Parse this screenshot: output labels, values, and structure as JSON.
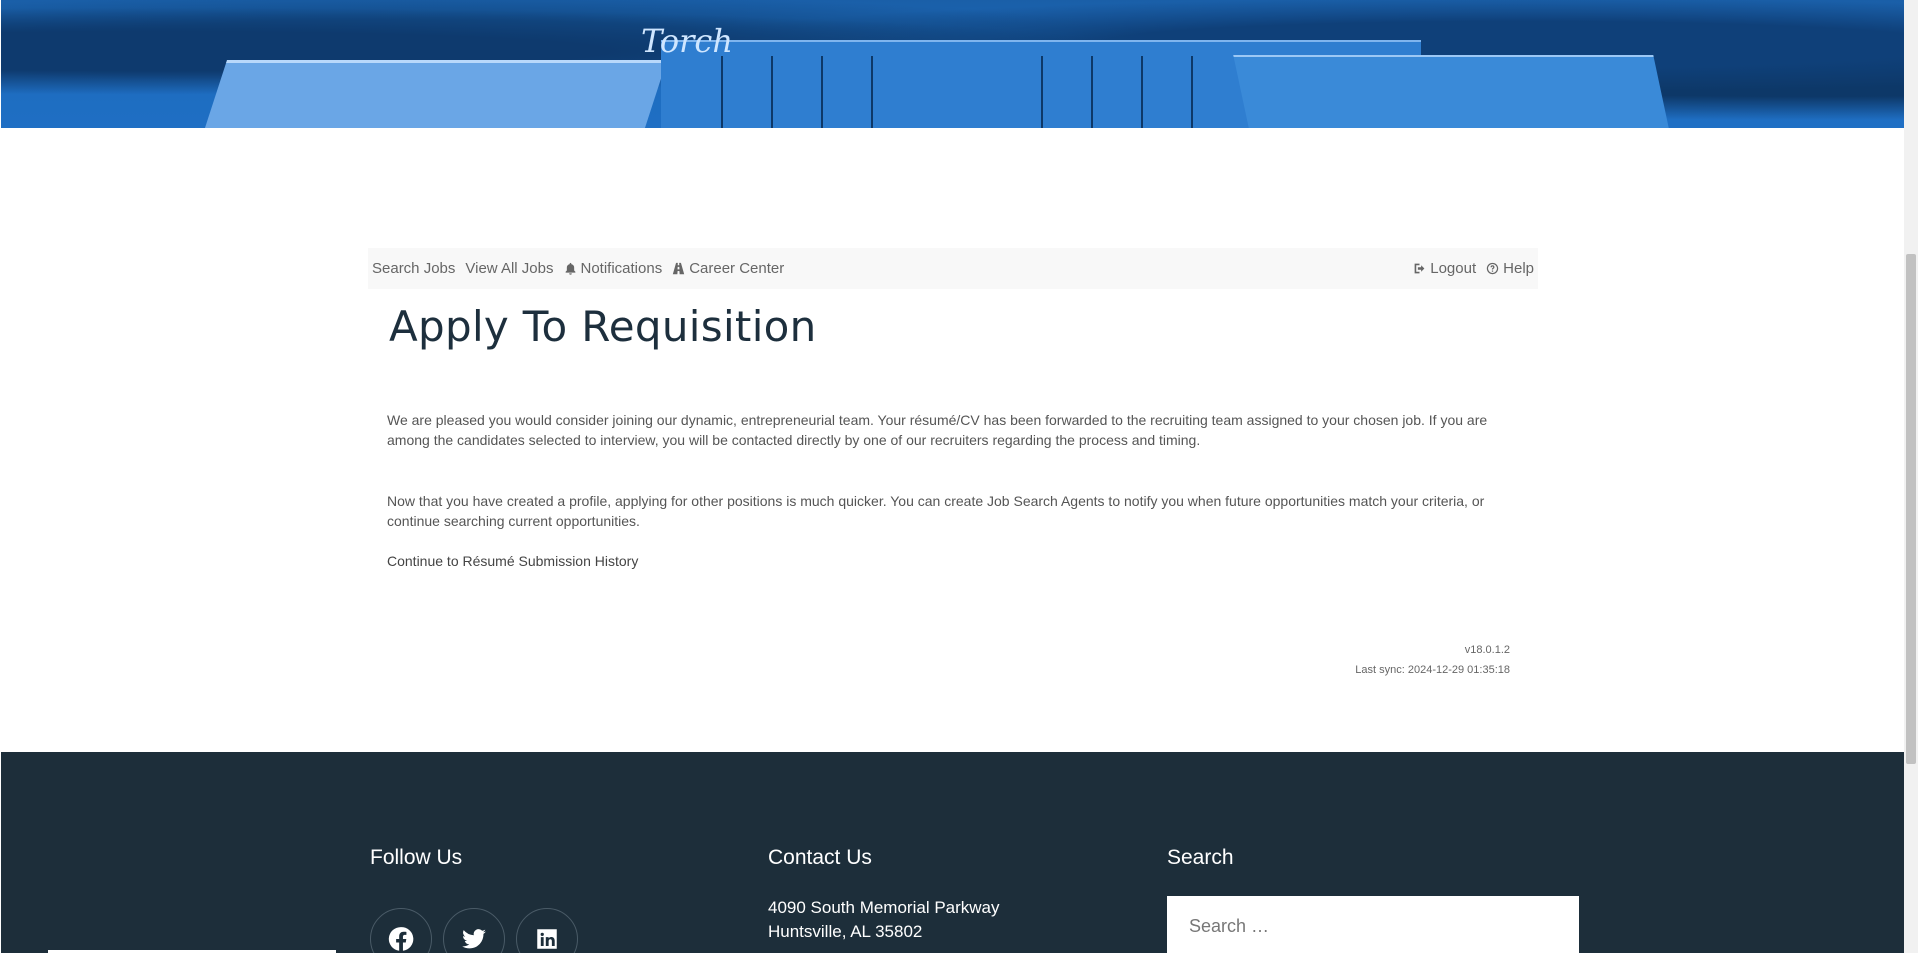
{
  "nav": {
    "search_jobs": "Search Jobs",
    "view_all_jobs": "View All Jobs",
    "notifications": "Notifications",
    "career_center": "Career Center",
    "logout": "Logout",
    "help": "Help"
  },
  "main": {
    "title": "Apply To Requisition",
    "paragraph1": "We are pleased you would consider joining our dynamic, entrepreneurial team. Your résumé/CV has been forwarded to the recruiting team assigned to your chosen job. If you are among the candidates selected to interview, you will be contacted directly by one of our recruiters regarding the process and timing.",
    "paragraph2": "Now that you have created a profile, applying for other positions is much quicker. You can create Job Search Agents to notify you when future opportunities match your criteria, or continue searching current opportunities.",
    "continue_link": "Continue to Résumé Submission History"
  },
  "meta": {
    "version": "v18.0.1.2",
    "last_sync": "Last sync: 2024-12-29 01:35:18"
  },
  "hero": {
    "sign_text": "Torch"
  },
  "footer": {
    "follow_title": "Follow Us",
    "contact_title": "Contact Us",
    "search_title": "Search",
    "address_line1": "4090 South Memorial Parkway",
    "address_line2": "Huntsville, AL 35802",
    "search_placeholder": "Search …",
    "social": [
      "facebook-icon",
      "twitter-icon",
      "linkedin-icon"
    ]
  },
  "colors": {
    "hero_blue": "#1f6fc4",
    "footer_bg": "#1d2e3a",
    "title": "#1d2f3d",
    "navbar_bg": "#f8f8f8"
  }
}
